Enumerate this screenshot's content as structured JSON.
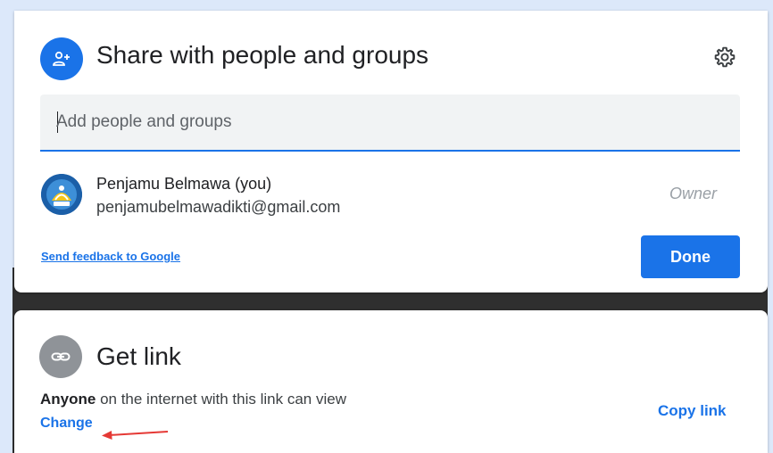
{
  "share": {
    "title": "Share with people and groups",
    "icon": "person-add-icon",
    "settings_icon": "gear-icon",
    "input": {
      "placeholder": "Add people and groups",
      "value": ""
    },
    "people": [
      {
        "name": "Penjamu Belmawa (you)",
        "email": "penjamubelmawadikti@gmail.com",
        "role": "Owner",
        "avatar_icon": "tut-wuri-handayani-logo"
      }
    ],
    "feedback_label": "Send feedback to Google",
    "done_label": "Done"
  },
  "link": {
    "title": "Get link",
    "icon": "link-icon",
    "access_prefix": "Anyone",
    "access_suffix": " on the internet with this link can view",
    "change_label": "Change",
    "copy_label": "Copy link"
  },
  "annotation": {
    "arrow_color": "#e53935"
  },
  "colors": {
    "accent": "#1a73e8",
    "link_icon_bg": "#8f9398"
  }
}
